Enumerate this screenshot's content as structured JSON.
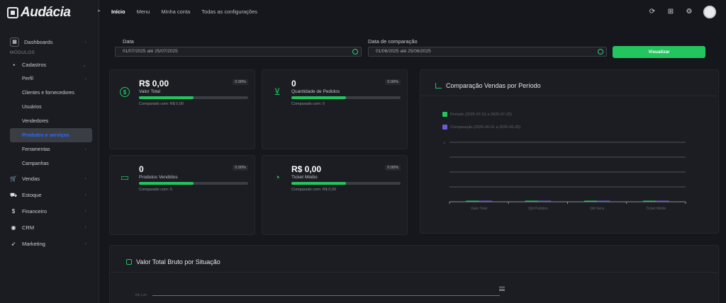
{
  "app": {
    "logo_text": "Audácia"
  },
  "sidebar": {
    "dashboards_label": "Dashboards",
    "section_label": "MÓDULOS",
    "cadastros_label": "Cadastros",
    "cadastros_items": [
      {
        "label": "Perfil",
        "has_chevron": true
      },
      {
        "label": "Clientes e fornecedores"
      },
      {
        "label": "Usuários"
      },
      {
        "label": "Vendedores"
      },
      {
        "label": "Produtos e serviços",
        "active": true
      },
      {
        "label": "Ferramentas",
        "has_chevron": true
      },
      {
        "label": "Campanhas"
      }
    ],
    "modules": [
      {
        "label": "Vendas",
        "icon": "cart-icon"
      },
      {
        "label": "Estoque",
        "icon": "truck-icon"
      },
      {
        "label": "Financeiro",
        "icon": "dollar-icon"
      },
      {
        "label": "CRM",
        "icon": "crm-icon"
      },
      {
        "label": "Marketing",
        "icon": "megaphone-icon"
      }
    ]
  },
  "topbar": {
    "nav": [
      "Início",
      "Menu",
      "Minha conta",
      "Todas as configurações"
    ],
    "icons": [
      "refresh-icon",
      "apps-grid-icon",
      "settings-icon",
      "avatar"
    ]
  },
  "filters": {
    "date_label": "Data",
    "date_value": "01/07/2025 até 25/07/2025",
    "compare_label": "Data de comparação",
    "compare_value": "01/06/2025 até 25/06/2025",
    "submit_label": "Visualizar"
  },
  "kpis": [
    {
      "value": "R$ 0,00",
      "label": "Valor Total",
      "pct": "0.00%",
      "compare": "Comparado com: R$ 0,00",
      "icon": "dollar-circle-icon",
      "progress": 0.5
    },
    {
      "value": "0",
      "label": "Quantidade de Pedidos",
      "pct": "0.00%",
      "compare": "Comparado com: 0",
      "icon": "cart-icon",
      "progress": 0.5
    },
    {
      "value": "0",
      "label": "Produtos Vendidos",
      "pct": "0.00%",
      "compare": "Comparado com: 0",
      "icon": "box-icon",
      "progress": 0.5
    },
    {
      "value": "R$ 0,00",
      "label": "Ticket Médio",
      "pct": "0.00%",
      "compare": "Comparado com: R$ 0,00",
      "icon": "pie-chart-icon",
      "progress": 0.5
    }
  ],
  "comparison_chart": {
    "title": "Comparação Vendas por Período"
  },
  "chart_data": {
    "type": "bar",
    "categories": [
      "Valor Total",
      "Qtd Pedidos",
      "Qtd Itens",
      "Ticket Médio"
    ],
    "series": [
      {
        "name": "Período (2025-07-01 a 2025-07-25)",
        "values": [
          0,
          0,
          0,
          0
        ],
        "color": "#22c55e"
      },
      {
        "name": "Comparação (2025-06-01 a 2025-06-25)",
        "values": [
          0,
          0,
          0,
          0
        ],
        "color": "#6b5bd6"
      }
    ],
    "ytick_labels": [
      "1"
    ],
    "ylim": [
      0,
      1
    ],
    "grid": true,
    "legend": "top-left"
  },
  "bottom_card": {
    "title": "Valor Total Bruto por Situação",
    "axis_label": "R$ 1,00"
  }
}
